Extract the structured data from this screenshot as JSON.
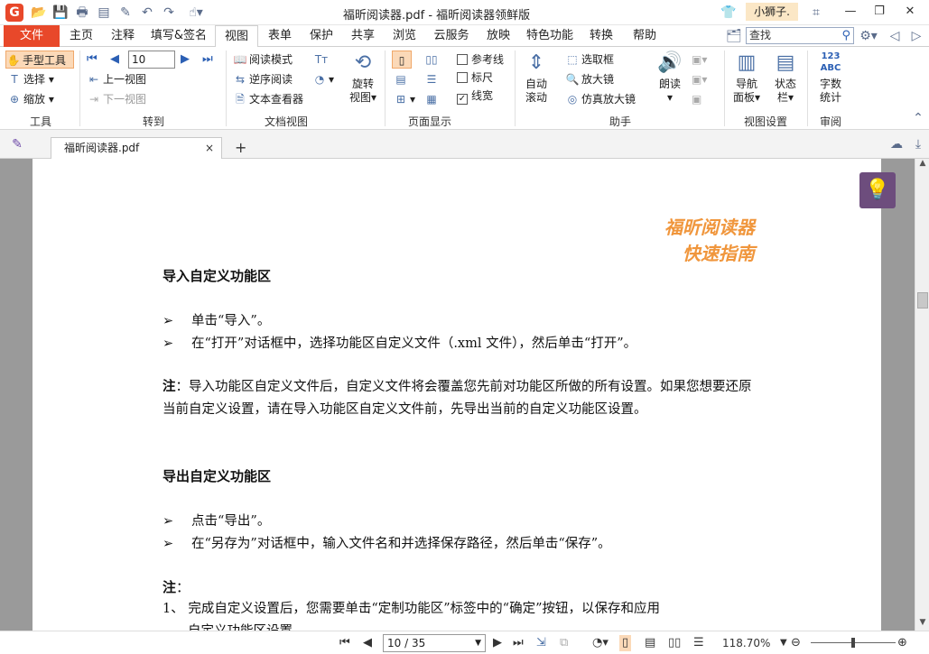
{
  "titlebar": {
    "logo": "G",
    "title": "福昕阅读器.pdf - 福昕阅读器领鲜版",
    "user": "小狮子.",
    "minimize": "—",
    "restore": "❐",
    "close": "✕"
  },
  "tabs": {
    "file": "文件",
    "items": [
      "主页",
      "注释",
      "填写&签名",
      "视图",
      "表单",
      "保护",
      "共享",
      "浏览",
      "云服务",
      "放映",
      "特色功能",
      "转换",
      "帮助"
    ],
    "active": "视图",
    "search_placeholder": "查找"
  },
  "ribbon": {
    "tools": {
      "hand": "手型工具",
      "select": "选择",
      "zoom": "缩放",
      "label": "工具"
    },
    "goto": {
      "page_value": "10",
      "prev_view": "上一视图",
      "next_view": "下一视图",
      "label": "转到"
    },
    "docview": {
      "read_mode": "阅读模式",
      "reverse": "逆序阅读",
      "text_viewer": "文本查看器",
      "rotate": "旋转",
      "rotate2": "视图",
      "label": "文档视图"
    },
    "pagedisplay": {
      "ref_lines": "参考线",
      "ruler": "标尺",
      "line_width": "线宽",
      "label": "页面显示"
    },
    "assist": {
      "auto_scroll1": "自动",
      "auto_scroll2": "滚动",
      "select_box": "选取框",
      "magnifier": "放大镜",
      "loupe": "仿真放大镜",
      "read_aloud": "朗读",
      "label": "助手"
    },
    "viewset": {
      "nav1": "导航",
      "nav2": "面板",
      "status1": "状态",
      "status2": "栏",
      "label": "视图设置"
    },
    "review": {
      "count_icon": "123 ABC",
      "count1": "字数",
      "count2": "统计",
      "label": "审阅"
    }
  },
  "doctab": {
    "name": "福昕阅读器.pdf",
    "close": "×",
    "new": "+"
  },
  "document": {
    "brand1": "福昕阅读器",
    "brand2": "快速指南",
    "import_title": "导入自定义功能区",
    "import_b1": "单击“导入”。",
    "import_b2": "在“打开”对话框中，选择功能区自定义文件（.xml 文件），然后单击“打开”。",
    "note1_label": "注",
    "note1_text": "：导入功能区自定义文件后，自定义文件将会覆盖您先前对功能区所做的所有设置。如果您想要还原当前自定义设置，请在导入功能区自定义文件前，先导出当前的自定义功能区设置。",
    "export_title": "导出自定义功能区",
    "export_b1": "点击“导出”。",
    "export_b2": "在“另存为”对话框中，输入文件名和并选择保存路径，然后单击“保存”。",
    "note2_label": "注",
    "note2_colon": "：",
    "item1": "1、 完成自定义设置后，您需要单击“定制功能区”标签中的“确定”按钮，以保存和应用",
    "item1_cont": "自定义功能区设置。"
  },
  "statusbar": {
    "page": "10 / 35",
    "zoom": "118.70%"
  }
}
